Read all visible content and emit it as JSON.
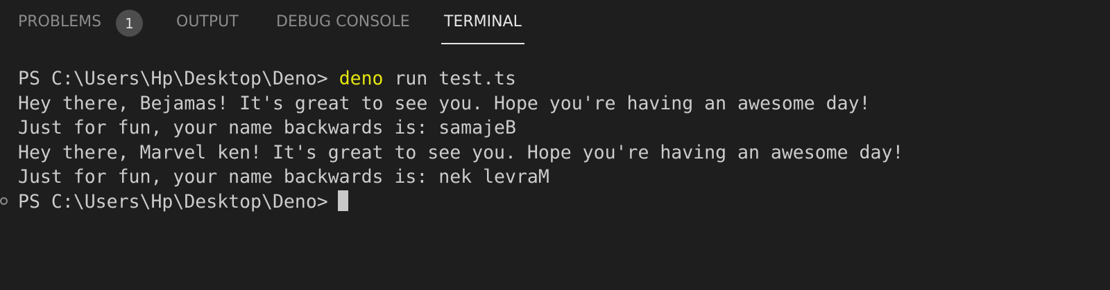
{
  "tabs": {
    "problems": {
      "label": "PROBLEMS",
      "badge": "1"
    },
    "output": {
      "label": "OUTPUT"
    },
    "debug_console": {
      "label": "DEBUG CONSOLE"
    },
    "terminal": {
      "label": "TERMINAL"
    }
  },
  "terminal": {
    "prompt": "PS C:\\Users\\Hp\\Desktop\\Deno> ",
    "command_highlight": "deno",
    "command_rest": " run test.ts",
    "output_lines": [
      "Hey there, Bejamas! It's great to see you. Hope you're having an awesome day!",
      "Just for fun, your name backwards is: samajeB",
      "Hey there, Marvel ken! It's great to see you. Hope you're having an awesome day!",
      "Just for fun, your name backwards is: nek levraM"
    ],
    "final_prompt": "PS C:\\Users\\Hp\\Desktop\\Deno>"
  },
  "colors": {
    "background": "#1e1e1e",
    "command_highlight": "#e5e510",
    "text": "#cccccc"
  }
}
